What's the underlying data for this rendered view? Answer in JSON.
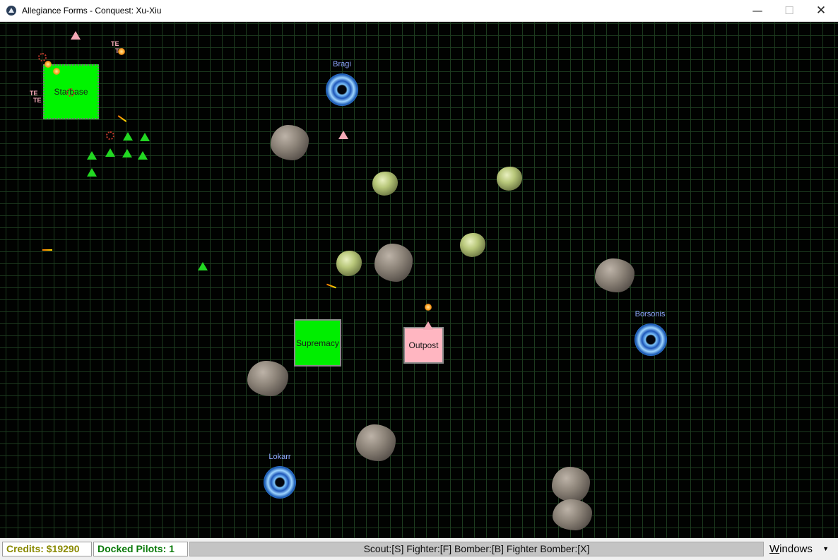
{
  "window": {
    "title": "Allegiance Forms - Conquest: Xu-Xiu",
    "minimize": "—",
    "maximize": "☐",
    "close": "✕"
  },
  "map": {
    "alephs": [
      {
        "name": "Bragi"
      },
      {
        "name": "Borsonis"
      },
      {
        "name": "Lokarr"
      }
    ],
    "stations": [
      {
        "name": "Starbase",
        "color": "#00f400"
      },
      {
        "name": "Supremacy",
        "color": "#00ee00"
      },
      {
        "name": "Outpost",
        "color": "#ffb6c1"
      }
    ],
    "ship_marker_labels": [
      "TE",
      "TE",
      "TE",
      "TE"
    ]
  },
  "statusbar": {
    "credits": "Credits: $19290",
    "docked": "Docked Pilots: 1",
    "shortcuts": "Scout:[S]  Fighter:[F]  Bomber:[B]  Fighter Bomber:[X]",
    "windows_first": "W",
    "windows_rest": "indows",
    "windows_caret": "▼"
  }
}
